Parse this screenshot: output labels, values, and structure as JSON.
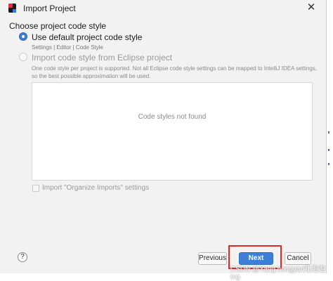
{
  "window": {
    "title": "Import Project",
    "close_glyph": "✕"
  },
  "section": {
    "heading": "Choose project code style"
  },
  "options": {
    "default": {
      "label": "Use default project code style",
      "hint": "Settings | Editor | Code Style",
      "selected": true
    },
    "eclipse": {
      "label": "Import code style from Eclipse project",
      "description_line1": "One code style per project is supported. Not all Eclipse code style settings can be mapped to IntelliJ IDEA settings,",
      "description_line2": "so the best possible approximation will be used.",
      "selected": false,
      "enabled": false
    }
  },
  "code_styles_panel": {
    "empty_text": "Code styles not found"
  },
  "organize_imports": {
    "label": "Import \"Organize Imports\" settings",
    "checked": false,
    "enabled": false
  },
  "footer": {
    "help_glyph": "?",
    "previous_label": "Previous",
    "next_label": "Next",
    "cancel_label": "Cancel"
  },
  "watermark": "CSDN @Yang hongyao吐泡泡ing",
  "colors": {
    "accent": "#3d7fd6",
    "highlight": "#e02828",
    "window_bg": "#f2f2f2"
  },
  "icons": {
    "app": "intellij-idea-icon",
    "close": "close-icon",
    "help": "help-icon"
  }
}
